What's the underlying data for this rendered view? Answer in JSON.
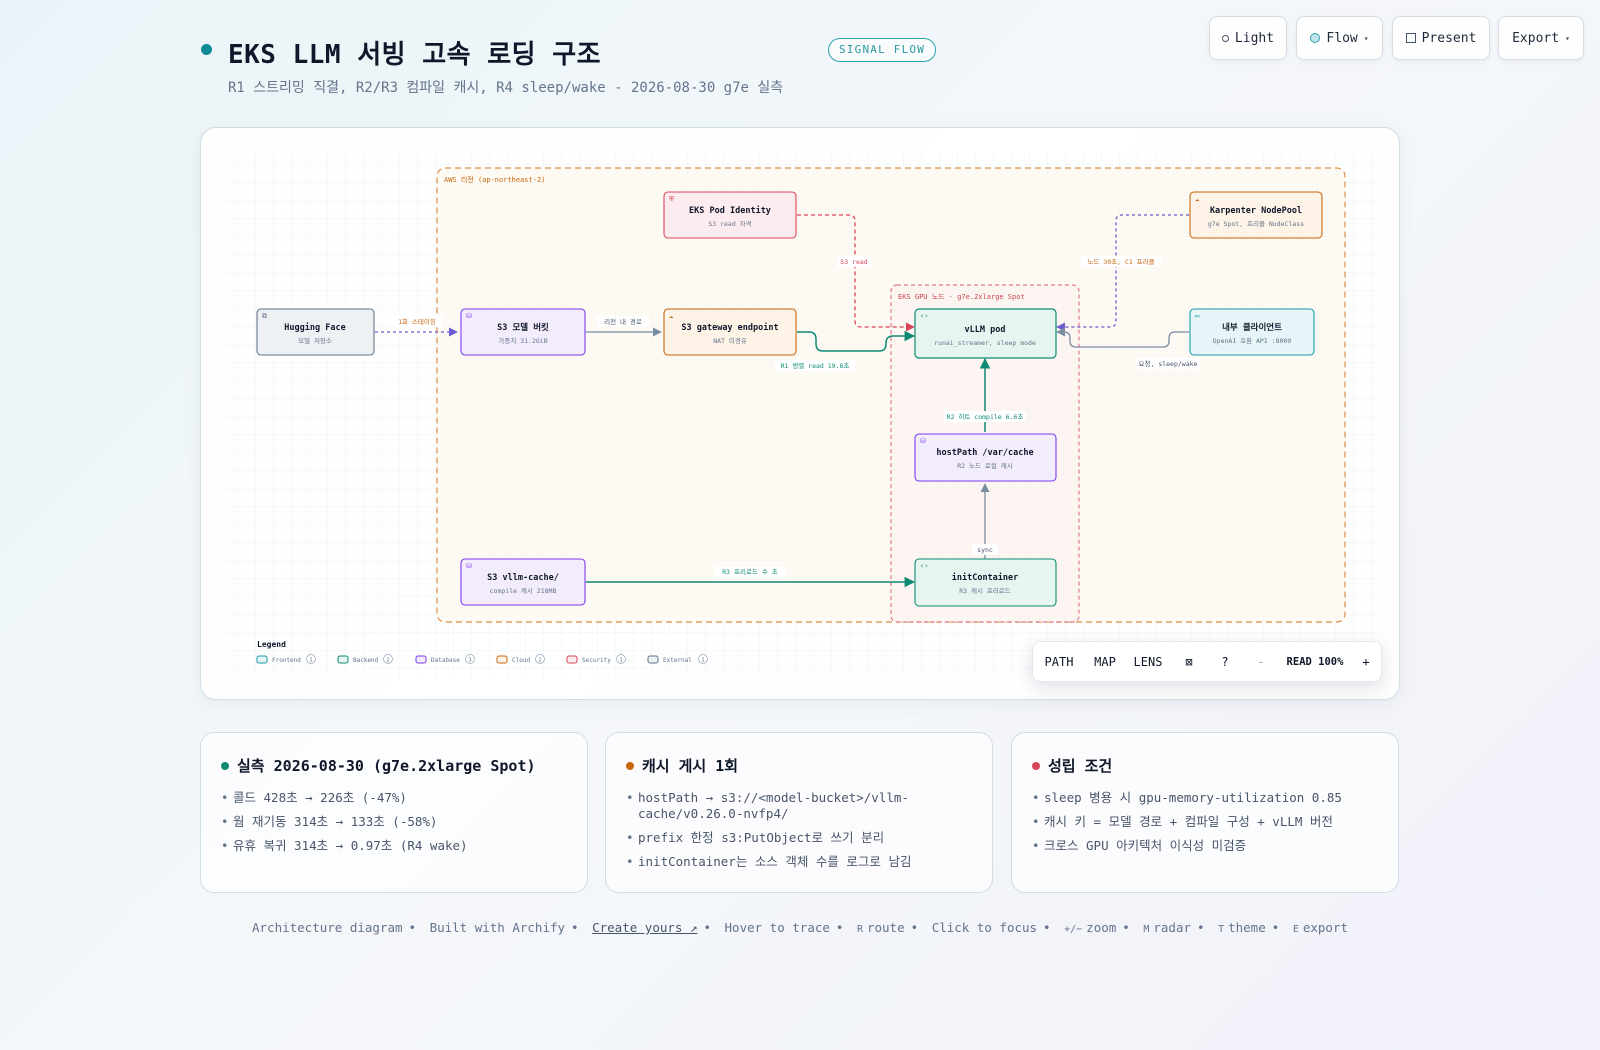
{
  "header": {
    "title": "EKS LLM 서빙 고속 로딩 구조",
    "subtitle": "R1 스트리밍 직결, R2/R3 컴파일 캐시, R4 sleep/wake - 2026-08-30 g7e 실측",
    "badge": "SIGNAL FLOW"
  },
  "top_buttons": {
    "light": "Light",
    "flow": "Flow",
    "present": "Present",
    "export": "Export",
    "caret": "▾"
  },
  "diagram": {
    "regions": {
      "aws": "AWS 리전 (ap-northeast-2)",
      "gpu_node": "EKS GPU 노드 · g7e.2xlarge Spot"
    },
    "nodes": {
      "hf": {
        "title": "Hugging Face",
        "sub": "모델 저장소"
      },
      "s3_bucket": {
        "title": "S3 모델 버킷",
        "sub": "가중치 31.2GiB"
      },
      "s3_gateway": {
        "title": "S3 gateway endpoint",
        "sub": "NAT 미경유"
      },
      "pod_identity": {
        "title": "EKS Pod Identity",
        "sub": "S3 read 자격"
      },
      "vllm_pod": {
        "title": "vLLM pod",
        "sub": "runai_streamer, sleep mode"
      },
      "karpenter": {
        "title": "Karpenter NodePool",
        "sub": "g7e Spot, 프리플 NodeClass"
      },
      "client": {
        "title": "내부 클라이언트",
        "sub": "OpenAI 호환 API :8000"
      },
      "hostpath": {
        "title": "hostPath /var/cache",
        "sub": "R2 노드 로컬 캐시"
      },
      "s3_cache": {
        "title": "S3 vllm-cache/",
        "sub": "compile 캐시 218MB"
      },
      "init": {
        "title": "initContainer",
        "sub": "R3 캐시 프리로드"
      }
    },
    "edges": {
      "hf_s3": "1회 스테이징",
      "s3_gw": "리전 내 경로",
      "gw_vllm": "R1 병렬 read 19.8초",
      "pi_vllm": "S3 read",
      "karp_vllm": "노드 30초, C1 프리플",
      "client_vllm": "요청, sleep/wake",
      "host_vllm": "R2 히트 compile 6.6초",
      "init_host": "sync",
      "cache_init": "R3 프리로드 수 초"
    },
    "legend": {
      "title": "Legend",
      "items": [
        {
          "label": "Frontend",
          "count": "1"
        },
        {
          "label": "Backend",
          "count": "2"
        },
        {
          "label": "Database",
          "count": "3"
        },
        {
          "label": "Cloud",
          "count": "2"
        },
        {
          "label": "Security",
          "count": "1"
        },
        {
          "label": "External",
          "count": "1"
        }
      ]
    }
  },
  "toolbar": {
    "path": "PATH",
    "map": "MAP",
    "lens": "LENS",
    "fit": "⊠",
    "help": "?",
    "zoom_out": "-",
    "read": "READ 100%",
    "zoom_in": "+"
  },
  "cards": [
    {
      "title": "실측 2026-08-30 (g7e.2xlarge Spot)",
      "items": [
        "콜드 428초 → 226초 (-47%)",
        "웜 재기동 314초 → 133초 (-58%)",
        "유휴 복귀 314초 → 0.97초 (R4 wake)"
      ]
    },
    {
      "title": "캐시 게시 1회",
      "items": [
        "hostPath → s3://<model-bucket>/vllm-cache/v0.26.0-nvfp4/",
        "prefix 한정 s3:PutObject로 쓰기 분리",
        "initContainer는 소스 객체 수를 로그로 남김"
      ]
    },
    {
      "title": "성립 조건",
      "items": [
        "sleep 병용 시 gpu-memory-utilization 0.85",
        "캐시 키 = 모델 경로 + 컴파일 구성 + vLLM 버전",
        "크로스 GPU 아키텍처 이식성 미검증"
      ]
    }
  ],
  "footer": {
    "t1": "Architecture diagram",
    "t2": "Built with Archify",
    "link": "Create yours ↗",
    "t3": "Hover to trace",
    "k_route": "R",
    "t_route": "route",
    "t4": "Click to focus",
    "k_zoom": "+/−",
    "t_zoom": "zoom",
    "k_radar": "M",
    "t_radar": "radar",
    "k_theme": "T",
    "t_theme": "theme",
    "k_export": "E",
    "t_export": "export",
    "sep": "•"
  },
  "colors": {
    "accent": "#0e8a95",
    "frontend": "#1a9aaa",
    "backend": "#0e8a73",
    "database": "#7c3aed",
    "cloud": "#c8660c",
    "security": "#d9465a",
    "external": "#64748b",
    "karpenter_edge": "#6d5bd0"
  }
}
